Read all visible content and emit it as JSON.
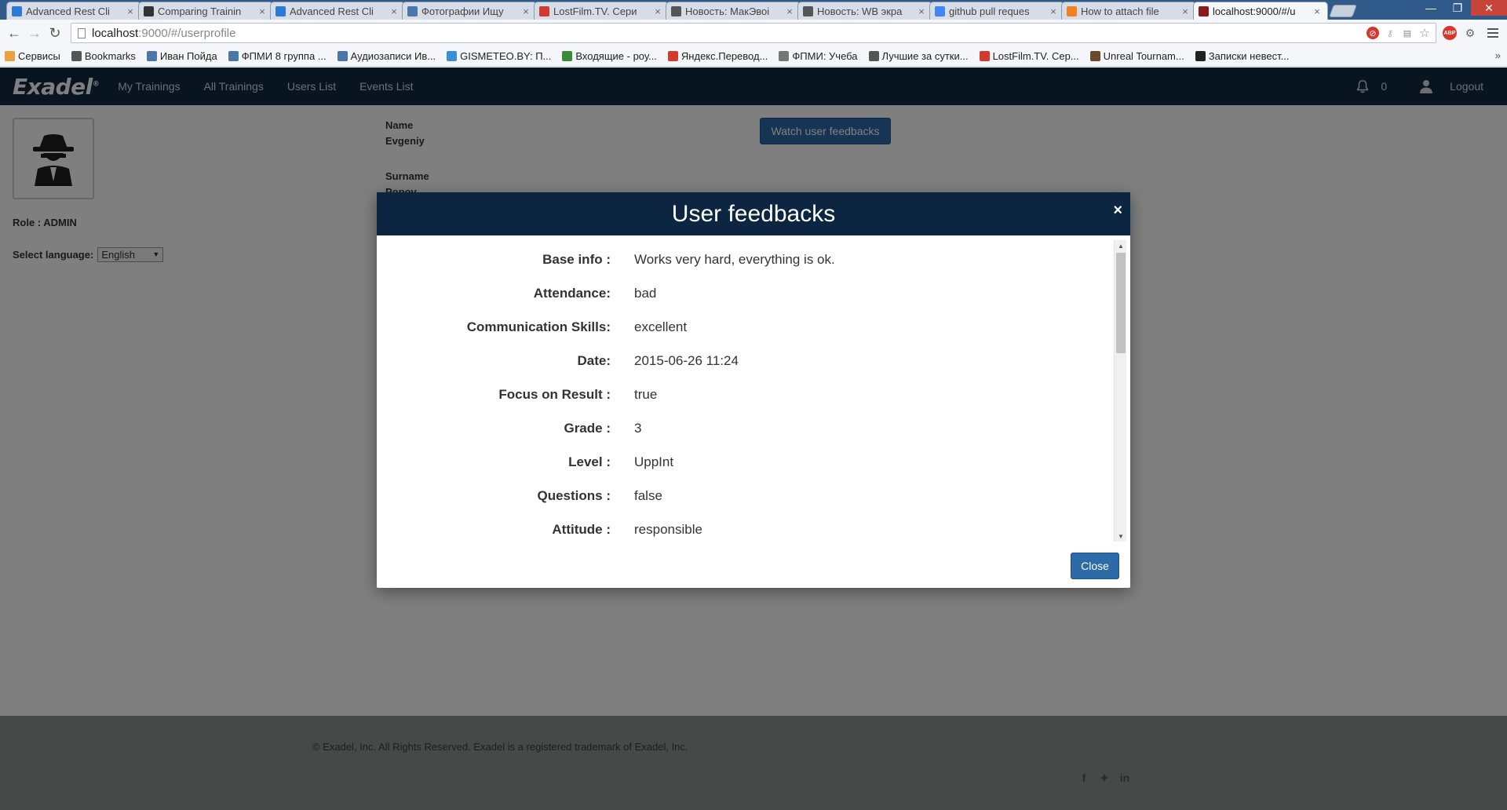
{
  "browser": {
    "tabs": [
      {
        "title": "Advanced Rest Cli",
        "favicon": "rest-client-icon",
        "color": "#2a7bd8"
      },
      {
        "title": "Comparing Trainin",
        "favicon": "github-icon",
        "color": "#333333"
      },
      {
        "title": "Advanced Rest Cli",
        "favicon": "rest-client-icon",
        "color": "#2a7bd8"
      },
      {
        "title": "Фотографии Ищу",
        "favicon": "vk-icon",
        "color": "#4a76a8"
      },
      {
        "title": "LostFilm.TV. Сери",
        "favicon": "lostfilm-icon",
        "color": "#d13b2b"
      },
      {
        "title": "Новость: МакЭвоі",
        "favicon": "news-icon",
        "color": "#555555"
      },
      {
        "title": "Новость: WB экра",
        "favicon": "news-icon",
        "color": "#555555"
      },
      {
        "title": "github pull reques",
        "favicon": "google-icon",
        "color": "#4285f4"
      },
      {
        "title": "How to attach file",
        "favicon": "stackoverflow-icon",
        "color": "#f48024"
      },
      {
        "title": "localhost:9000/#/u",
        "favicon": "spy-icon",
        "color": "#8b1a1a"
      }
    ],
    "address": {
      "host": "localhost",
      "path": ":9000/#/userprofile"
    },
    "bookmarks": [
      {
        "label": "Сервисы",
        "icon": "apps-icon",
        "color": "#e8a33d"
      },
      {
        "label": "Bookmarks",
        "icon": "star-icon",
        "color": "#555555"
      },
      {
        "label": "Иван Пойда",
        "icon": "vk-icon",
        "color": "#4a76a8"
      },
      {
        "label": "ФПМИ 8 группа ...",
        "icon": "vk-icon",
        "color": "#4a76a8"
      },
      {
        "label": "Аудиозаписи Ив...",
        "icon": "vk-icon",
        "color": "#4a76a8"
      },
      {
        "label": "GISMETEO.BY: П...",
        "icon": "weather-icon",
        "color": "#3a8ed8"
      },
      {
        "label": "Входящие - роу...",
        "icon": "mail-icon",
        "color": "#3b8b3b"
      },
      {
        "label": "Яндекс.Перевод...",
        "icon": "yandex-icon",
        "color": "#d13b2b"
      },
      {
        "label": "ФПМИ: Учеба",
        "icon": "page-icon",
        "color": "#777777"
      },
      {
        "label": "Лучшие за сутки...",
        "icon": "news-icon",
        "color": "#555555"
      },
      {
        "label": "LostFilm.TV. Сер...",
        "icon": "lostfilm-icon",
        "color": "#d13b2b"
      },
      {
        "label": "Unreal Tournam...",
        "icon": "game-icon",
        "color": "#6b4a2a"
      },
      {
        "label": "Записки невест...",
        "icon": "e-icon",
        "color": "#222222"
      }
    ],
    "bookmarks_more": "»"
  },
  "app": {
    "logo": "Exadel",
    "logo_mark": "®",
    "nav": [
      "My Trainings",
      "All Trainings",
      "Users List",
      "Events List"
    ],
    "notifications_count": "0",
    "logout": "Logout"
  },
  "profile": {
    "role": "Role : ADMIN",
    "language_label": "Select language:",
    "language_value": "English",
    "name_label": "Name",
    "name_value": "Evgeniy",
    "surname_label": "Surname",
    "surname_value": "Popov",
    "watch_button": "Watch user feedbacks"
  },
  "footer": {
    "copyright": "© Exadel, Inc. All Rights Reserved. Exadel is a registered trademark of Exadel, Inc."
  },
  "modal": {
    "title": "User feedbacks",
    "close_x": "×",
    "close_button": "Close",
    "fields": [
      {
        "label": "Base info :",
        "value": "Works very hard, everything is ok."
      },
      {
        "label": "Attendance:",
        "value": "bad"
      },
      {
        "label": "Communication Skills:",
        "value": "excellent"
      },
      {
        "label": "Date:",
        "value": "2015-06-26 11:24"
      },
      {
        "label": "Focus on Result :",
        "value": "true"
      },
      {
        "label": "Grade :",
        "value": "3"
      },
      {
        "label": "Level :",
        "value": "UppInt"
      },
      {
        "label": "Questions :",
        "value": "false"
      },
      {
        "label": "Attitude :",
        "value": "responsible"
      }
    ],
    "scroll_position": 0.0
  },
  "colors": {
    "navbar": "#102a43",
    "modal_header": "#0c2540",
    "primary_button": "#2d6aa8",
    "footer": "#8a9590"
  }
}
